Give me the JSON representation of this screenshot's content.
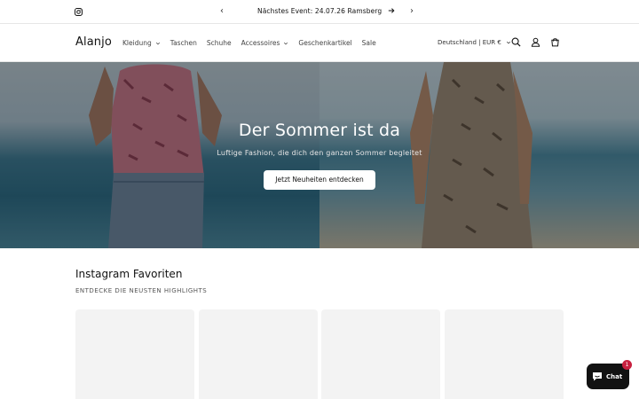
{
  "announcement": {
    "message": "Nächstes Event: 24.07.26 Ramsberg",
    "prev_label": "‹",
    "next_label": "›"
  },
  "header": {
    "logo": "Alanjo",
    "nav": [
      {
        "label": "Kleidung",
        "has_dropdown": true
      },
      {
        "label": "Taschen",
        "has_dropdown": false
      },
      {
        "label": "Schuhe",
        "has_dropdown": false
      },
      {
        "label": "Accessoires",
        "has_dropdown": true
      },
      {
        "label": "Geschenkartikel",
        "has_dropdown": false
      },
      {
        "label": "Sale",
        "has_dropdown": false
      }
    ],
    "country": "Deutschland | EUR €",
    "icons": [
      "search-icon",
      "account-icon",
      "cart-icon"
    ]
  },
  "hero": {
    "title": "Der Sommer ist da",
    "subtitle": "Luftige Fashion, die dich den ganzen Sommer begleitet",
    "button": "Jetzt Neuheiten entdecken"
  },
  "instagram": {
    "title": "Instagram Favoriten",
    "subtitle": "ENTDECKE DIE NEUSTEN HIGHLIGHTS",
    "tile_count": 4
  },
  "chat": {
    "label": "Chat",
    "badge": "1",
    "color": "#121212",
    "badge_color": "#c8203f"
  }
}
